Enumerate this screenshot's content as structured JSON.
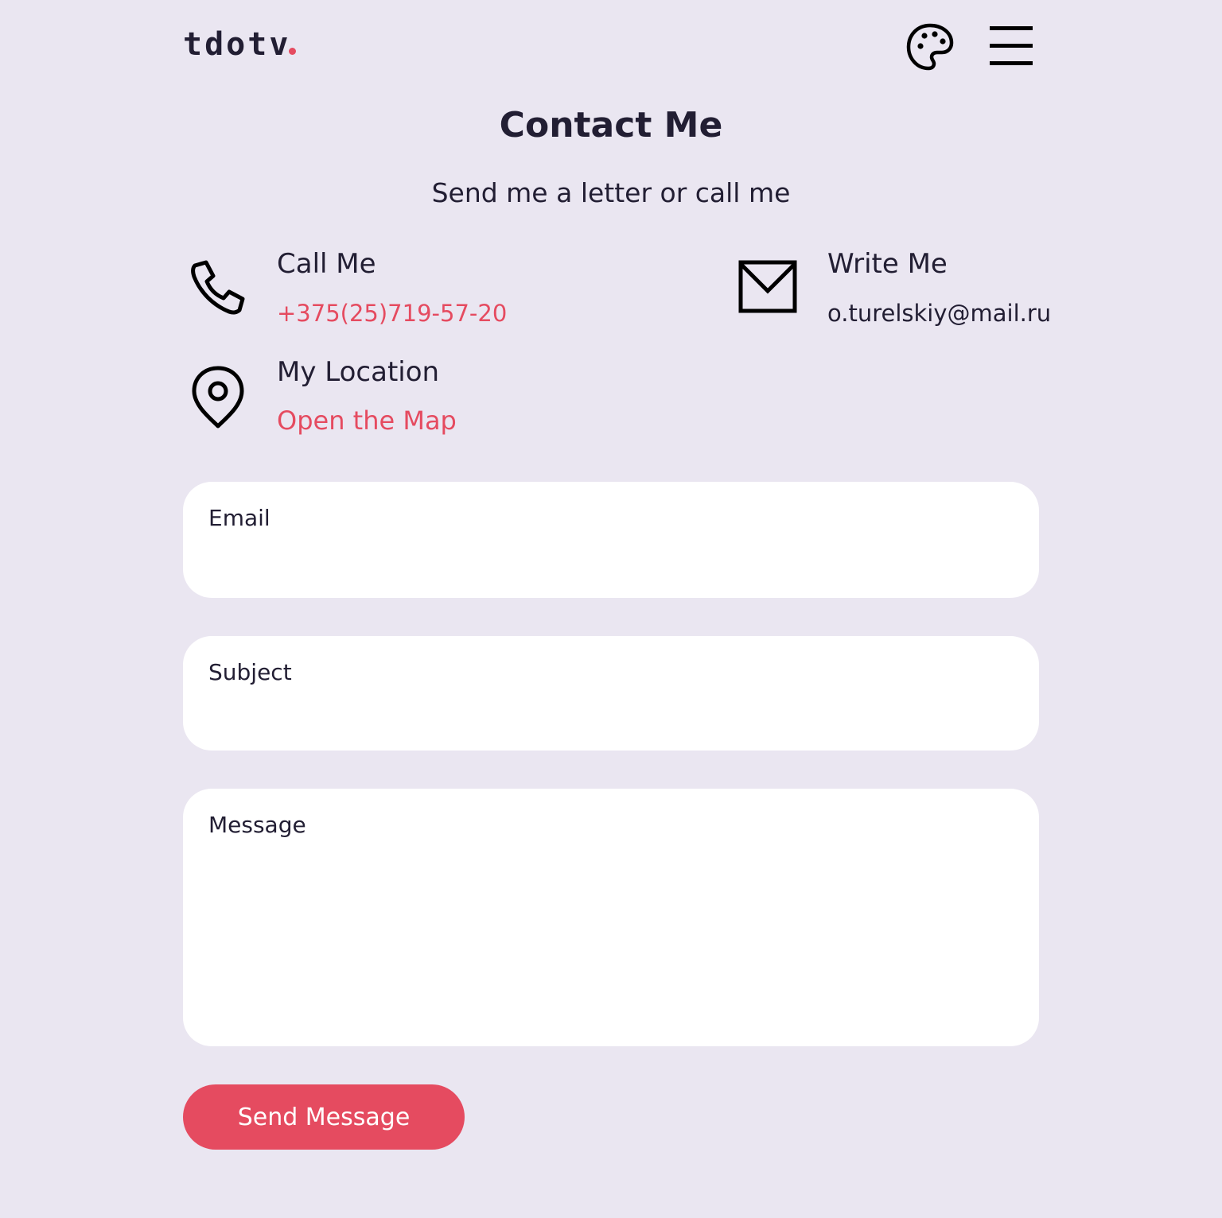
{
  "colors": {
    "background": "#eae6f1",
    "text": "#221e33",
    "accent": "#e54b60",
    "field_background": "#ffffff"
  },
  "header": {
    "logo_text": "tdotv",
    "palette_icon": "palette-icon",
    "menu_icon": "hamburger-menu-icon"
  },
  "page": {
    "title": "Contact Me",
    "subtitle": "Send me a letter or call me"
  },
  "contacts": {
    "call": {
      "icon": "phone-icon",
      "label": "Call Me",
      "value": "+375(25)719-57-20"
    },
    "write": {
      "icon": "envelope-icon",
      "label": "Write Me",
      "value": "o.turelskiy@mail.ru"
    },
    "location": {
      "icon": "map-pin-icon",
      "label": "My Location",
      "value": "Open the Map"
    }
  },
  "form": {
    "email": {
      "label": "Email",
      "value": ""
    },
    "subject": {
      "label": "Subject",
      "value": ""
    },
    "message": {
      "label": "Message",
      "value": ""
    },
    "submit_label": "Send Message"
  }
}
